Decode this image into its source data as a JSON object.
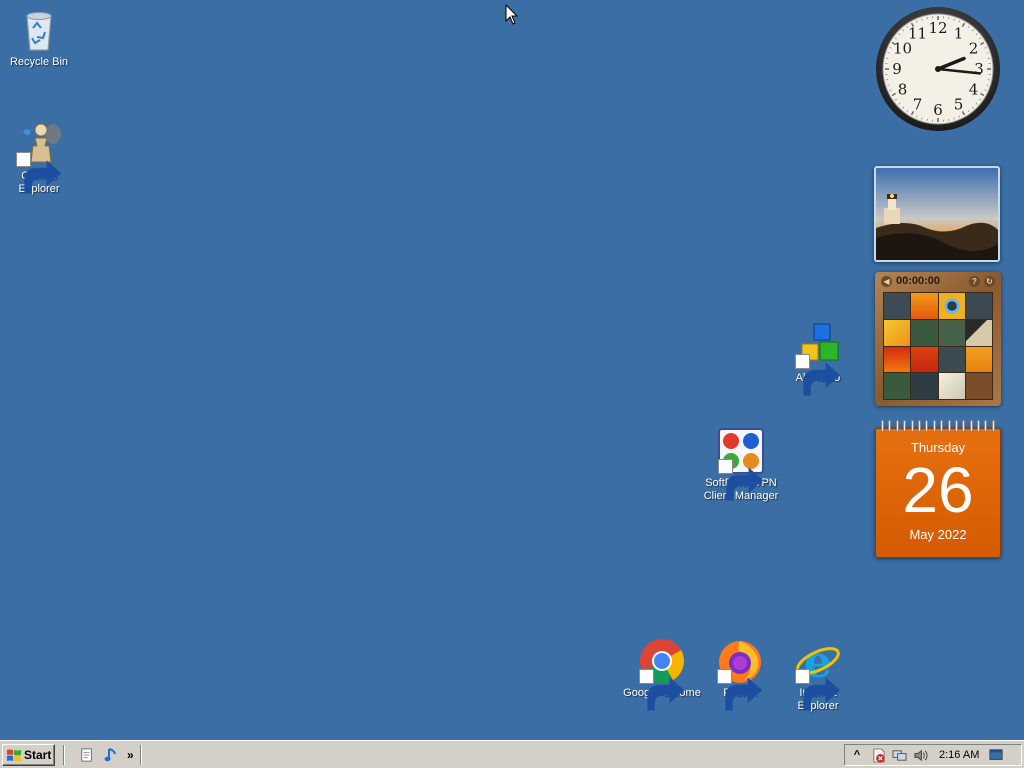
{
  "desktop": {
    "background_color": "#3a6ea5",
    "icons": [
      {
        "id": "recycle-bin",
        "label": "Recycle Bin",
        "icon": "recycle-bin-icon"
      },
      {
        "id": "games-explorer",
        "label": "Games\nExplorer",
        "icon": "games-explorer-icon"
      },
      {
        "id": "all-radio",
        "label": "All-Radio",
        "icon": "all-radio-icon"
      },
      {
        "id": "softether",
        "label": "SoftEther VPN\nClient Manager",
        "icon": "softether-vpn-icon"
      },
      {
        "id": "chrome",
        "label": "Google Chrome",
        "icon": "chrome-icon"
      },
      {
        "id": "firefox",
        "label": "Firefox",
        "icon": "firefox-icon"
      },
      {
        "id": "ie",
        "label": "Internet\nExplorer",
        "icon": "internet-explorer-icon"
      }
    ]
  },
  "gadgets": {
    "clock": {
      "hour": 2,
      "minute": 16,
      "numerals": [
        "12",
        "1",
        "2",
        "3",
        "4",
        "5",
        "6",
        "7",
        "8",
        "9",
        "10",
        "11"
      ]
    },
    "slideshow": {
      "icon": "lighthouse-photo"
    },
    "puzzle": {
      "timer": "00:00:00",
      "help_icon": "question-icon",
      "shuffle_icon": "shuffle-icon"
    },
    "calendar": {
      "day_name": "Thursday",
      "day_number": "26",
      "month_year": "May 2022",
      "color": "#e06808"
    }
  },
  "taskbar": {
    "start_label": "Start",
    "quicklaunch": [
      "show-desktop-icon",
      "media-player-icon"
    ],
    "chevron": "»",
    "tray": {
      "expand": "^",
      "icons": [
        "security-alert-icon",
        "network-icon",
        "volume-icon"
      ],
      "time": "2:16 AM",
      "desktop_icon": "show-desktop-tray-icon"
    }
  }
}
